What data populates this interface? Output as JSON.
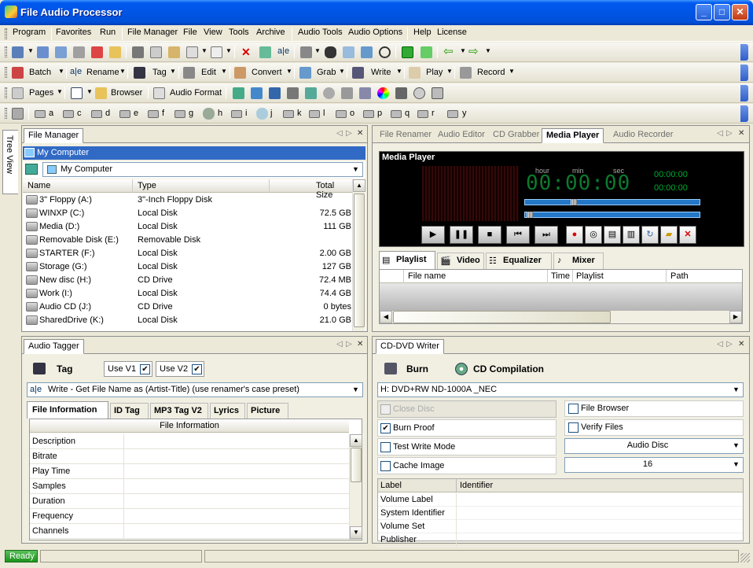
{
  "window": {
    "title": "File Audio Processor"
  },
  "menu": [
    "Program",
    "Favorites",
    "Run",
    "File Manager",
    "File",
    "View",
    "Tools",
    "Archive",
    "Audio Tools",
    "Audio Options",
    "Help",
    "License"
  ],
  "toolbar3": {
    "batch": "Batch",
    "rename": "Rename",
    "tag": "Tag",
    "edit": "Edit",
    "convert": "Convert",
    "grab": "Grab",
    "write": "Write",
    "play": "Play",
    "record": "Record"
  },
  "toolbar4": {
    "pages": "Pages",
    "browser": "Browser",
    "audio_format": "Audio Format"
  },
  "toolbar5": [
    "a",
    "c",
    "d",
    "e",
    "f",
    "g",
    "h",
    "i",
    "j",
    "k",
    "l",
    "o",
    "p",
    "q",
    "r",
    "y"
  ],
  "side_tab": "Tree View",
  "file_manager": {
    "tab": "File Manager",
    "root": "My Computer",
    "path": "My Computer",
    "columns": {
      "name": "Name",
      "type": "Type",
      "size": "Total Size"
    },
    "rows": [
      {
        "name": "3\" Floppy (A:)",
        "type": "3\"-Inch Floppy Disk",
        "size": ""
      },
      {
        "name": "WINXP (C:)",
        "type": "Local Disk",
        "size": "72.5 GB"
      },
      {
        "name": "Media (D:)",
        "type": "Local Disk",
        "size": "111 GB"
      },
      {
        "name": "Removable Disk (E:)",
        "type": "Removable Disk",
        "size": ""
      },
      {
        "name": "STARTER (F:)",
        "type": "Local Disk",
        "size": "2.00 GB"
      },
      {
        "name": "Storage (G:)",
        "type": "Local Disk",
        "size": "127 GB"
      },
      {
        "name": "New disc (H:)",
        "type": "CD Drive",
        "size": "72.4 MB"
      },
      {
        "name": "Work (I:)",
        "type": "Local Disk",
        "size": "74.4 GB"
      },
      {
        "name": "Audio CD (J:)",
        "type": "CD Drive",
        "size": "0 bytes"
      },
      {
        "name": "SharedDrive (K:)",
        "type": "Local Disk",
        "size": "21.0 GB"
      }
    ]
  },
  "right_tabs": {
    "t1": "File Renamer",
    "t2": "Audio Editor",
    "t3": "CD Grabber",
    "t4": "Media Player",
    "t5": "Audio Recorder"
  },
  "media_player": {
    "title": "Media Player",
    "labels": {
      "hour": "hour",
      "min": "min",
      "sec": "sec"
    },
    "time_display": "00:00:00",
    "elapsed": "00:00:00",
    "total": "00:00:00",
    "tabs": {
      "playlist": "Playlist",
      "video": "Video",
      "equalizer": "Equalizer",
      "mixer": "Mixer"
    },
    "columns": {
      "file": "File name",
      "time": "Time",
      "playlist": "Playlist",
      "path": "Path"
    }
  },
  "audio_tagger": {
    "tab": "Audio Tagger",
    "tag": "Tag",
    "use_v1": "Use V1",
    "use_v2": "Use V2",
    "preset": "Write - Get File Name as (Artist-Title) (use renamer's case preset)",
    "tabs": {
      "info": "File Information",
      "id": "ID Tag",
      "mp3": "MP3 Tag V2",
      "lyrics": "Lyrics",
      "picture": "Picture"
    },
    "header": "File Information",
    "rows": [
      "Description",
      "Bitrate",
      "Play Time",
      "Samples",
      "Duration",
      "Frequency",
      "Channels"
    ]
  },
  "cd_writer": {
    "tab": "CD-DVD Writer",
    "burn": "Burn",
    "compilation": "CD Compilation",
    "drive": "H: DVD+RW ND-1000A _NEC",
    "close_disc": "Close Disc",
    "file_browser": "File Browser",
    "burn_proof": "Burn Proof",
    "verify_files": "Verify Files",
    "test_write": "Test Write Mode",
    "disc_type": "Audio Disc",
    "cache_image": "Cache Image",
    "speed": "16",
    "columns": {
      "label": "Label",
      "identifier": "Identifier"
    },
    "rows": [
      "Volume Label",
      "System Identifier",
      "Volume Set",
      "Publisher"
    ]
  },
  "status": {
    "text": "Ready"
  }
}
